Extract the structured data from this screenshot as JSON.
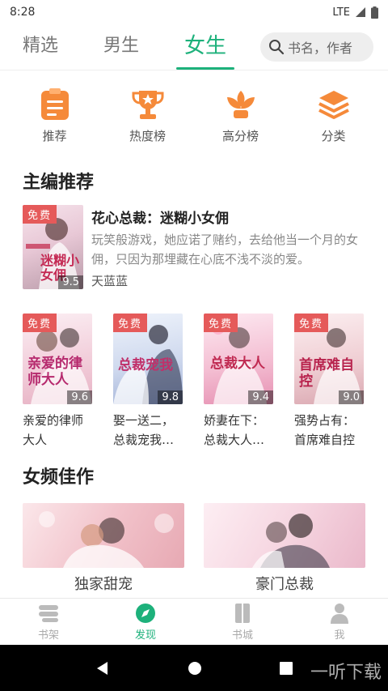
{
  "status": {
    "time": "8:28",
    "network": "LTE"
  },
  "tabs": [
    {
      "label": "精选",
      "active": false
    },
    {
      "label": "男生",
      "active": false
    },
    {
      "label": "女生",
      "active": true
    }
  ],
  "search": {
    "placeholder": "书名，作者"
  },
  "shortcuts": [
    {
      "label": "推荐",
      "icon": "clipboard-icon"
    },
    {
      "label": "热度榜",
      "icon": "trophy-icon"
    },
    {
      "label": "高分榜",
      "icon": "flower-icon"
    },
    {
      "label": "分类",
      "icon": "layers-icon"
    }
  ],
  "editor_pick": {
    "section_title": "主编推荐",
    "badge": "免费",
    "score": "9.5",
    "title": "花心总裁：迷糊小女佣",
    "description": "玩笑般游戏，她应诺了赌约，去给他当一个月的女佣，只因为那埋藏在心底不浅不淡的爱。",
    "author": "天蓝蓝",
    "cover_text": "迷糊小女佣"
  },
  "grid_books": [
    {
      "badge": "免费",
      "score": "9.6",
      "title": "亲爱的律师大人",
      "cover_text": "亲爱的律师大人"
    },
    {
      "badge": "免费",
      "score": "9.8",
      "title": "娶一送二，总裁宠我…",
      "cover_text": "总裁宠我"
    },
    {
      "badge": "免费",
      "score": "9.4",
      "title": "娇妻在下：总裁大人…",
      "cover_text": "总裁大人"
    },
    {
      "badge": "免费",
      "score": "9.0",
      "title": "强势占有：首席难自控",
      "cover_text": "首席难自控"
    }
  ],
  "female_works": {
    "section_title": "女频佳作",
    "banners": [
      {
        "label": "独家甜宠"
      },
      {
        "label": "豪门总裁"
      }
    ]
  },
  "bottom_nav": [
    {
      "label": "书架",
      "icon": "bookshelf-icon",
      "active": false
    },
    {
      "label": "发现",
      "icon": "compass-icon",
      "active": true
    },
    {
      "label": "书城",
      "icon": "book-icon",
      "active": false
    },
    {
      "label": "我",
      "icon": "person-icon",
      "active": false
    }
  ],
  "watermark": "一听下载",
  "colors": {
    "accent": "#1db17b",
    "badge": "#e55a5a",
    "icon_orange": "#f58a3a"
  }
}
